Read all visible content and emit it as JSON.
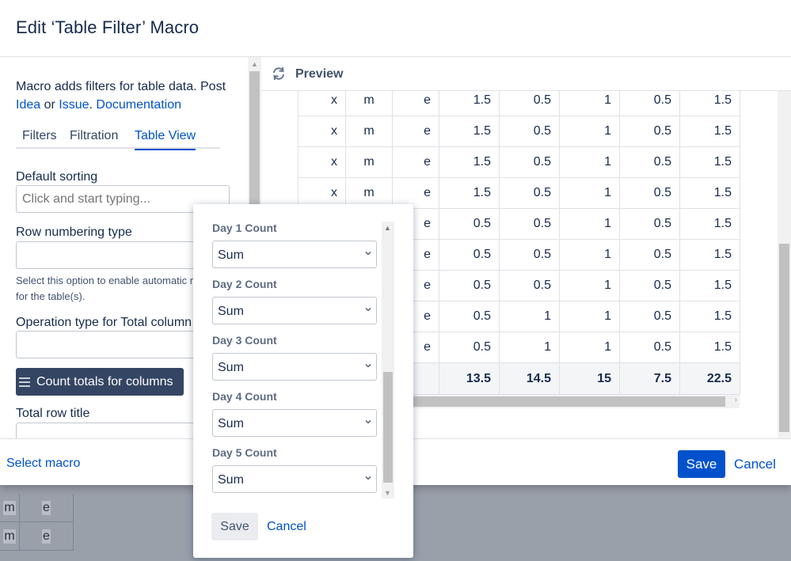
{
  "dialog": {
    "title": "Edit ‘Table Filter’ Macro"
  },
  "settings": {
    "description": "Macro adds filters for table data. Post",
    "link_idea": "Idea",
    "or_text": " or ",
    "link_issue": "Issue",
    "period": ". ",
    "link_docs": "Documentation",
    "tabs": [
      {
        "label": "Filters",
        "active": false
      },
      {
        "label": "Filtration",
        "active": false
      },
      {
        "label": "Table View",
        "active": true
      }
    ],
    "default_sorting_label": "Default sorting",
    "default_sorting_placeholder": "Click and start typing...",
    "row_numbering_label": "Row numbering type",
    "row_numbering_hint": "Select this option to enable automatic numbering for the table(s).",
    "operation_type_label": "Operation type for Total column",
    "count_totals_button": "Count totals for columns",
    "total_row_title_label": "Total row title"
  },
  "preview": {
    "label": "Preview",
    "rows": [
      [
        "x",
        "m",
        "e",
        "1.5",
        "0.5",
        "1",
        "0.5",
        "1.5"
      ],
      [
        "x",
        "m",
        "e",
        "1.5",
        "0.5",
        "1",
        "0.5",
        "1.5"
      ],
      [
        "x",
        "m",
        "e",
        "1.5",
        "0.5",
        "1",
        "0.5",
        "1.5"
      ],
      [
        "x",
        "m",
        "e",
        "1.5",
        "0.5",
        "1",
        "0.5",
        "1.5"
      ],
      [
        "",
        "",
        "e",
        "0.5",
        "0.5",
        "1",
        "0.5",
        "1.5"
      ],
      [
        "",
        "",
        "e",
        "0.5",
        "0.5",
        "1",
        "0.5",
        "1.5"
      ],
      [
        "",
        "",
        "e",
        "0.5",
        "0.5",
        "1",
        "0.5",
        "1.5"
      ],
      [
        "",
        "",
        "e",
        "0.5",
        "1",
        "1",
        "0.5",
        "1.5"
      ],
      [
        "",
        "",
        "e",
        "0.5",
        "1",
        "1",
        "0.5",
        "1.5"
      ]
    ],
    "totals": [
      "",
      "",
      "",
      "13.5",
      "14.5",
      "15",
      "7.5",
      "22.5"
    ]
  },
  "popup": {
    "fields": [
      {
        "label": "Day 1 Count",
        "value": "Sum"
      },
      {
        "label": "Day 2 Count",
        "value": "Sum"
      },
      {
        "label": "Day 3 Count",
        "value": "Sum"
      },
      {
        "label": "Day 4 Count",
        "value": "Sum"
      },
      {
        "label": "Day 5 Count",
        "value": "Sum"
      }
    ],
    "save_label": "Save",
    "cancel_label": "Cancel"
  },
  "footer": {
    "select_macro": "Select macro",
    "save_label": "Save",
    "cancel_label": "Cancel"
  },
  "background_table": {
    "rows": [
      [
        "m",
        "e"
      ],
      [
        "m",
        "e"
      ]
    ]
  },
  "colors": {
    "primary": "#0052cc",
    "dark_button": "#344563",
    "text": "#172b4d"
  }
}
